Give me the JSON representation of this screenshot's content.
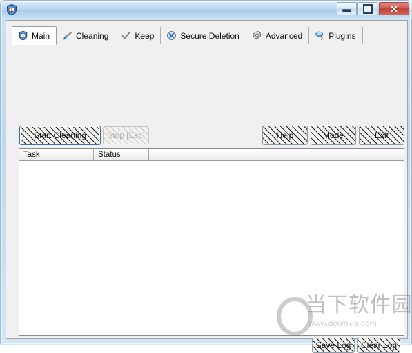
{
  "window": {
    "title": "",
    "icon": "shield-one-icon",
    "caption_buttons": {
      "minimize": "–",
      "maximize": "□",
      "close": "✕"
    }
  },
  "tabs": [
    {
      "label": "Main",
      "icon": "shield-one-icon",
      "selected": true
    },
    {
      "label": "Cleaning",
      "icon": "broom-icon",
      "selected": false
    },
    {
      "label": "Keep",
      "icon": "checkmark-icon",
      "selected": false
    },
    {
      "label": "Secure Deletion",
      "icon": "wrench-circle-icon",
      "selected": false
    },
    {
      "label": "Advanced",
      "icon": "gear-icon",
      "selected": false
    },
    {
      "label": "Plugins",
      "icon": "plug-icon",
      "selected": false
    }
  ],
  "actions": {
    "start_cleaning": {
      "label": "Start Cleaning",
      "mnemonic": "C",
      "enabled": true,
      "focused": true
    },
    "stop": {
      "label": "Stop [Esc]",
      "mnemonic": "",
      "enabled": false,
      "focused": false
    },
    "help": {
      "label": "Help",
      "mnemonic": "H",
      "enabled": true,
      "focused": false
    },
    "mode": {
      "label": "Mode",
      "mnemonic": "M",
      "enabled": true,
      "focused": false
    },
    "exit": {
      "label": "Exit",
      "mnemonic": "x",
      "enabled": true,
      "focused": false
    },
    "save_log": {
      "label": "Save Log",
      "mnemonic": "S",
      "enabled": true,
      "focused": false
    },
    "clear_log": {
      "label": "Clear Log",
      "mnemonic": "C",
      "enabled": true,
      "focused": false
    }
  },
  "task_list": {
    "columns": [
      "Task",
      "Status"
    ],
    "rows": []
  },
  "watermark": {
    "logo": "O",
    "text": "当下软件园",
    "url": "www.downxia.com"
  },
  "colors": {
    "title_bar": "#b6d5f0",
    "client": "#f0f0f0",
    "close_button": "#bc3f35",
    "focus_border": "#3c6ea8",
    "list_background": "#ffffff"
  }
}
